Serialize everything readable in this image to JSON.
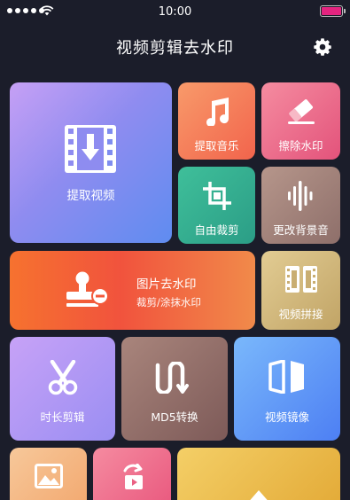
{
  "status_bar": {
    "time": "10:00",
    "battery_color": "#e3247f"
  },
  "header": {
    "title": "视频剪辑去水印",
    "settings_icon": "gear-icon"
  },
  "tiles": {
    "extract_video": {
      "label": "提取视频",
      "icon": "film-download-icon"
    },
    "extract_music": {
      "label": "提取音乐",
      "icon": "music-note-icon"
    },
    "remove_watermark": {
      "label": "擦除水印",
      "icon": "eraser-icon"
    },
    "free_crop": {
      "label": "自由裁剪",
      "icon": "crop-icon"
    },
    "change_bgm": {
      "label": "更改背景音",
      "icon": "sound-wave-icon"
    },
    "image_watermark": {
      "label": "图片去水印",
      "sub": "裁剪/涂抹水印",
      "icon": "stamp-icon"
    },
    "video_splice": {
      "label": "视频拼接",
      "icon": "film-splice-icon"
    },
    "duration_edit": {
      "label": "时长剪辑",
      "icon": "scissors-icon"
    },
    "md5_convert": {
      "label": "MD5转换",
      "icon": "wave-convert-icon"
    },
    "video_mirror": {
      "label": "视频镜像",
      "icon": "mirror-icon"
    },
    "bottom_1": {
      "icon": "image-icon"
    },
    "bottom_2": {
      "icon": "rotate-icon"
    },
    "bottom_3": {
      "icon": "triangle-icon"
    }
  }
}
